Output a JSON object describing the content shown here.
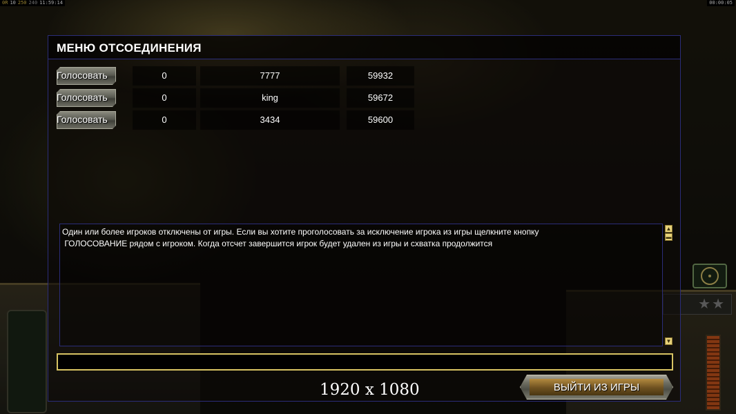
{
  "topbar": {
    "segments": [
      "0R",
      "10",
      "250",
      "240",
      "11:59:14"
    ],
    "right_timer": "00:00:05"
  },
  "hud": {
    "rank_stars": "★★"
  },
  "dialog": {
    "title": "МЕНЮ ОТСОЕДИНЕНИЯ",
    "players": [
      {
        "vote_label": "Голосовать",
        "ping": "0",
        "name": "7777",
        "time": "59932"
      },
      {
        "vote_label": "Голосовать",
        "ping": "0",
        "name": "king",
        "time": "59672"
      },
      {
        "vote_label": "Голосовать",
        "ping": "0",
        "name": "3434",
        "time": "59600"
      }
    ],
    "message_line1": "Один или более игроков отключены от игры. Если вы хотите проголосовать за исключение игрока из игры щелкните кнопку",
    "message_line2": " ГОЛОСОВАНИЕ рядом с игроком. Когда отсчет завершится игрок будет удален из игры и схватка продолжится",
    "scroll_up_icon": "arrow-up-icon",
    "scroll_down_icon": "arrow-down-icon",
    "exit_label": "ВЫЙТИ ИЗ ИГРЫ"
  },
  "overlay": {
    "resolution": "1920 x 1080"
  },
  "colors": {
    "dialog_border": "#2b2d7a",
    "input_border": "#d8c463",
    "exit_inner": "#b38a3f"
  }
}
